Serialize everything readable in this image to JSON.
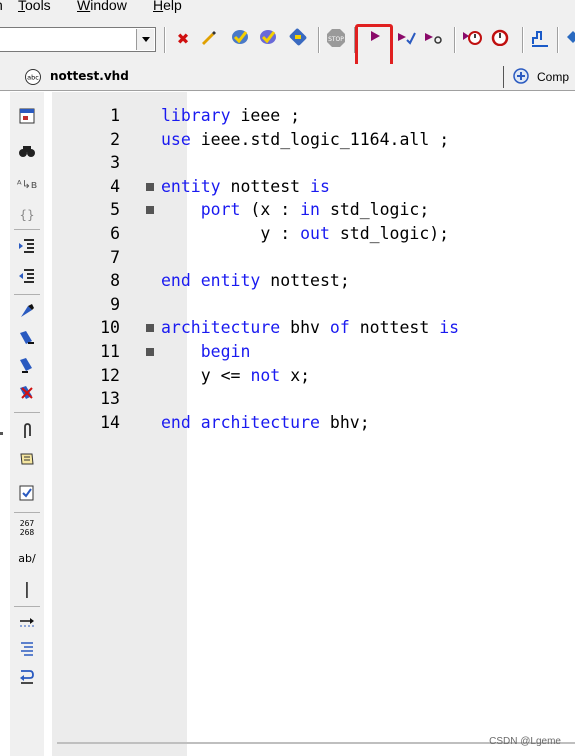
{
  "menu": [
    {
      "label": "Tools",
      "underline": "T",
      "rest": "ools"
    },
    {
      "label": "Window",
      "underline": "W",
      "rest": "indow"
    },
    {
      "label": "Help",
      "underline": "H",
      "rest": "elp"
    }
  ],
  "toolbar_icons": [
    "compile-icon",
    "pen-icon",
    "build-icon",
    "build-all-icon",
    "rebuild-icon",
    "stop-icon",
    "run-icon",
    "step-icon",
    "step-over-icon",
    "timer-icon",
    "stopwatch-icon",
    "waveform-icon",
    "extra-icon"
  ],
  "tab": {
    "label": "nottest.vhd",
    "icon": "vhdl-file-icon"
  },
  "compile_button": {
    "label": "Comp",
    "icon": "compile-report-icon"
  },
  "editor": {
    "lines": [
      {
        "num": "1",
        "text": "library ieee ;"
      },
      {
        "num": "2",
        "text": "use ieee.std_logic_1164.all ;"
      },
      {
        "num": "3",
        "text": ""
      },
      {
        "num": "4",
        "text": "entity nottest is"
      },
      {
        "num": "5",
        "text": "    port (x : in std_logic;"
      },
      {
        "num": "6",
        "text": "          y : out std_logic);"
      },
      {
        "num": "7",
        "text": ""
      },
      {
        "num": "8",
        "text": "end entity nottest;"
      },
      {
        "num": "9",
        "text": ""
      },
      {
        "num": "10",
        "text": "architecture bhv of nottest is"
      },
      {
        "num": "11",
        "text": "    begin"
      },
      {
        "num": "12",
        "text": "    y <= not x;"
      },
      {
        "num": "13",
        "text": ""
      },
      {
        "num": "14",
        "text": "end architecture bhv;"
      }
    ]
  },
  "watermark": "CSDN @Lgeme",
  "colors": {
    "keyword": "#1a1af0",
    "highlight": "#e02020",
    "gutter": "#ececec"
  }
}
